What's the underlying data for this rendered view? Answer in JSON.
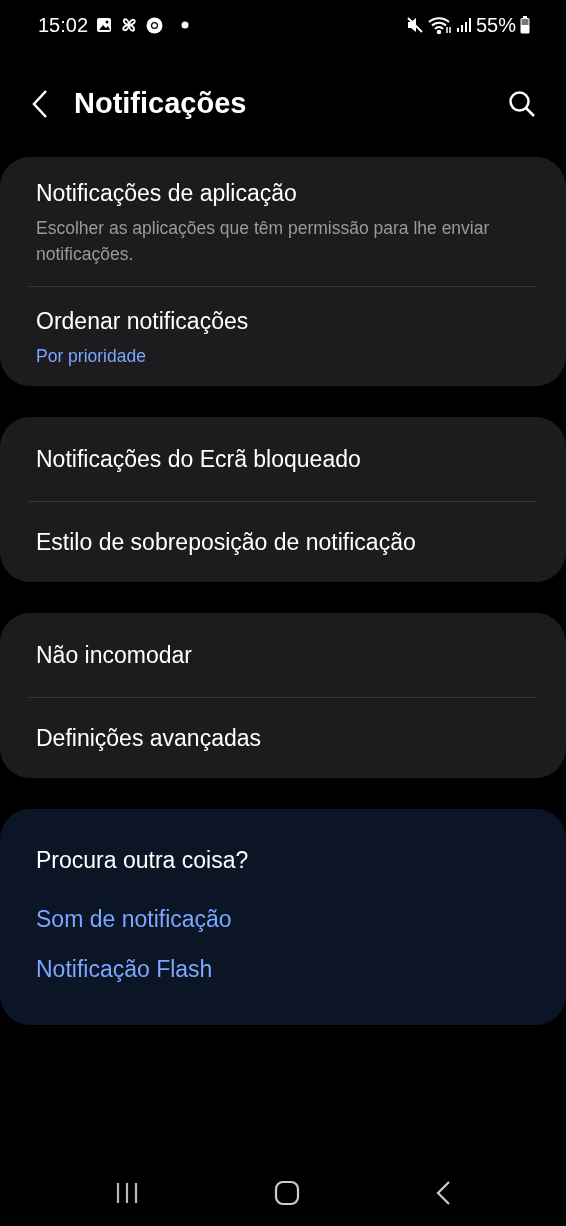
{
  "status_bar": {
    "time": "15:02",
    "battery": "55%"
  },
  "header": {
    "title": "Notificações"
  },
  "groups": [
    {
      "items": [
        {
          "title": "Notificações de aplicação",
          "description": "Escolher as aplicações que têm permissão para lhe enviar notificações."
        },
        {
          "title": "Ordenar notificações",
          "summary": "Por prioridade"
        }
      ]
    },
    {
      "items": [
        {
          "title": "Notificações do Ecrã bloqueado"
        },
        {
          "title": "Estilo de sobreposição de notificação"
        }
      ]
    },
    {
      "items": [
        {
          "title": "Não incomodar"
        },
        {
          "title": "Definições avançadas"
        }
      ]
    }
  ],
  "suggestions": {
    "title": "Procura outra coisa?",
    "links": [
      "Som de notificação",
      "Notificação Flash"
    ]
  }
}
